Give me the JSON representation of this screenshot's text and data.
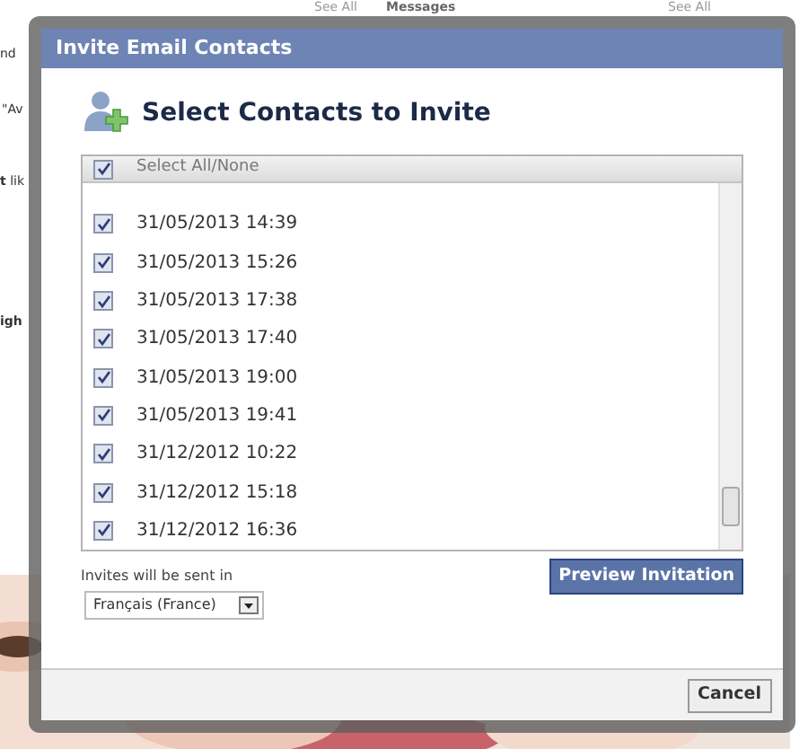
{
  "background": {
    "texts": [
      {
        "kind": "link",
        "text": "See All"
      },
      {
        "kind": "heading",
        "text": "Messages"
      },
      {
        "kind": "link",
        "text": "See All"
      },
      {
        "kind": "snippet",
        "text": "nd"
      },
      {
        "kind": "snippet",
        "text": "\"Av"
      },
      {
        "kind": "snippet",
        "text": "**t** lik"
      },
      {
        "kind": "tab",
        "text": "igh"
      }
    ]
  },
  "dialog": {
    "title": "Invite Email Contacts",
    "heading": "Select Contacts to Invite",
    "select_all": {
      "label": "Select All/None",
      "checked": true
    },
    "contacts": [
      {
        "label": "31/05/2013 14:39",
        "checked": true
      },
      {
        "label": "31/05/2013 15:26",
        "checked": true
      },
      {
        "label": "31/05/2013 17:38",
        "checked": true
      },
      {
        "label": "31/05/2013 17:40",
        "checked": true
      },
      {
        "label": "31/05/2013 19:00",
        "checked": true
      },
      {
        "label": "31/05/2013 19:41",
        "checked": true
      },
      {
        "label": "31/12/2012 10:22",
        "checked": true
      },
      {
        "label": "31/12/2012 15:18",
        "checked": true
      },
      {
        "label": "31/12/2012 16:36",
        "checked": true
      }
    ],
    "language_label": "Invites will be sent in",
    "language_value": "Français (France)",
    "preview_button": "Preview Invitation",
    "cancel_button": "Cancel"
  }
}
